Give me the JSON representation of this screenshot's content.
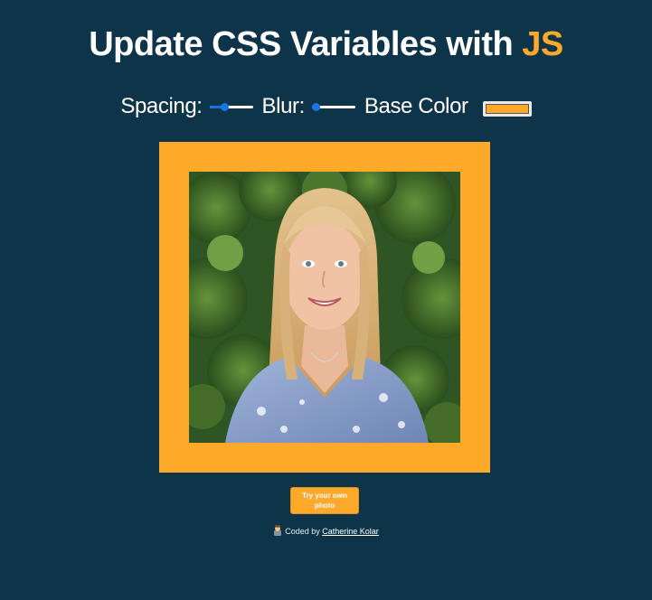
{
  "header": {
    "title_main": "Update CSS Variables with ",
    "title_highlight": "JS"
  },
  "controls": {
    "spacing_label": "Spacing:",
    "spacing_value": 0.35,
    "blur_label": "Blur:",
    "blur_value": 0.0,
    "base_color_label": "Base Color",
    "base_color_value": "#ffa92b"
  },
  "colors": {
    "background": "#0d3448",
    "accent": "#ffa92b",
    "slider": "#1a73e8"
  },
  "photo": {
    "icon": "portrait-photo"
  },
  "actions": {
    "upload_label": "Try your own photo"
  },
  "footer": {
    "emoji_icon": "technologist-emoji-icon",
    "coded_by": "Coded by",
    "author": "Catherine Kolar"
  }
}
